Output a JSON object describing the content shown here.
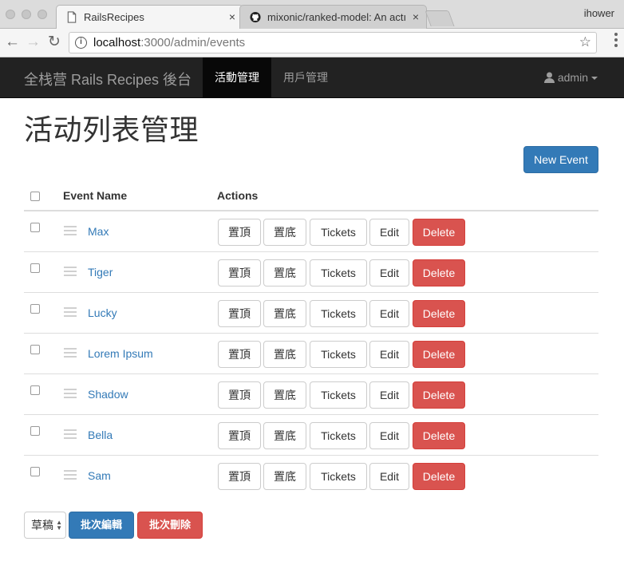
{
  "browser": {
    "tabs": [
      {
        "title": "RailsRecipes",
        "active": true
      },
      {
        "title": "mixonic/ranked-model: An actı",
        "active": false
      }
    ],
    "profile_name": "ihower",
    "url_host": "localhost",
    "url_path": ":3000/admin/events",
    "tab_close": "×"
  },
  "navbar": {
    "brand": "全栈营 Rails Recipes 後台",
    "links": [
      {
        "label": "活動管理",
        "active": true
      },
      {
        "label": "用戶管理",
        "active": false
      }
    ],
    "user": "admin"
  },
  "page": {
    "title": "活动列表管理",
    "new_event": "New Event"
  },
  "table": {
    "headers": {
      "name": "Event Name",
      "actions": "Actions"
    },
    "events": [
      "Max",
      "Tiger",
      "Lucky",
      "Lorem Ipsum",
      "Shadow",
      "Bella",
      "Sam"
    ],
    "actions": {
      "top": "置頂",
      "bottom": "置底",
      "tickets": "Tickets",
      "edit": "Edit",
      "delete": "Delete"
    }
  },
  "batch": {
    "status_select": "草稿",
    "edit": "批次編輯",
    "delete": "批次刪除"
  },
  "colors": {
    "primary": "#337ab7",
    "danger": "#d9534f",
    "navbar": "#222222"
  }
}
